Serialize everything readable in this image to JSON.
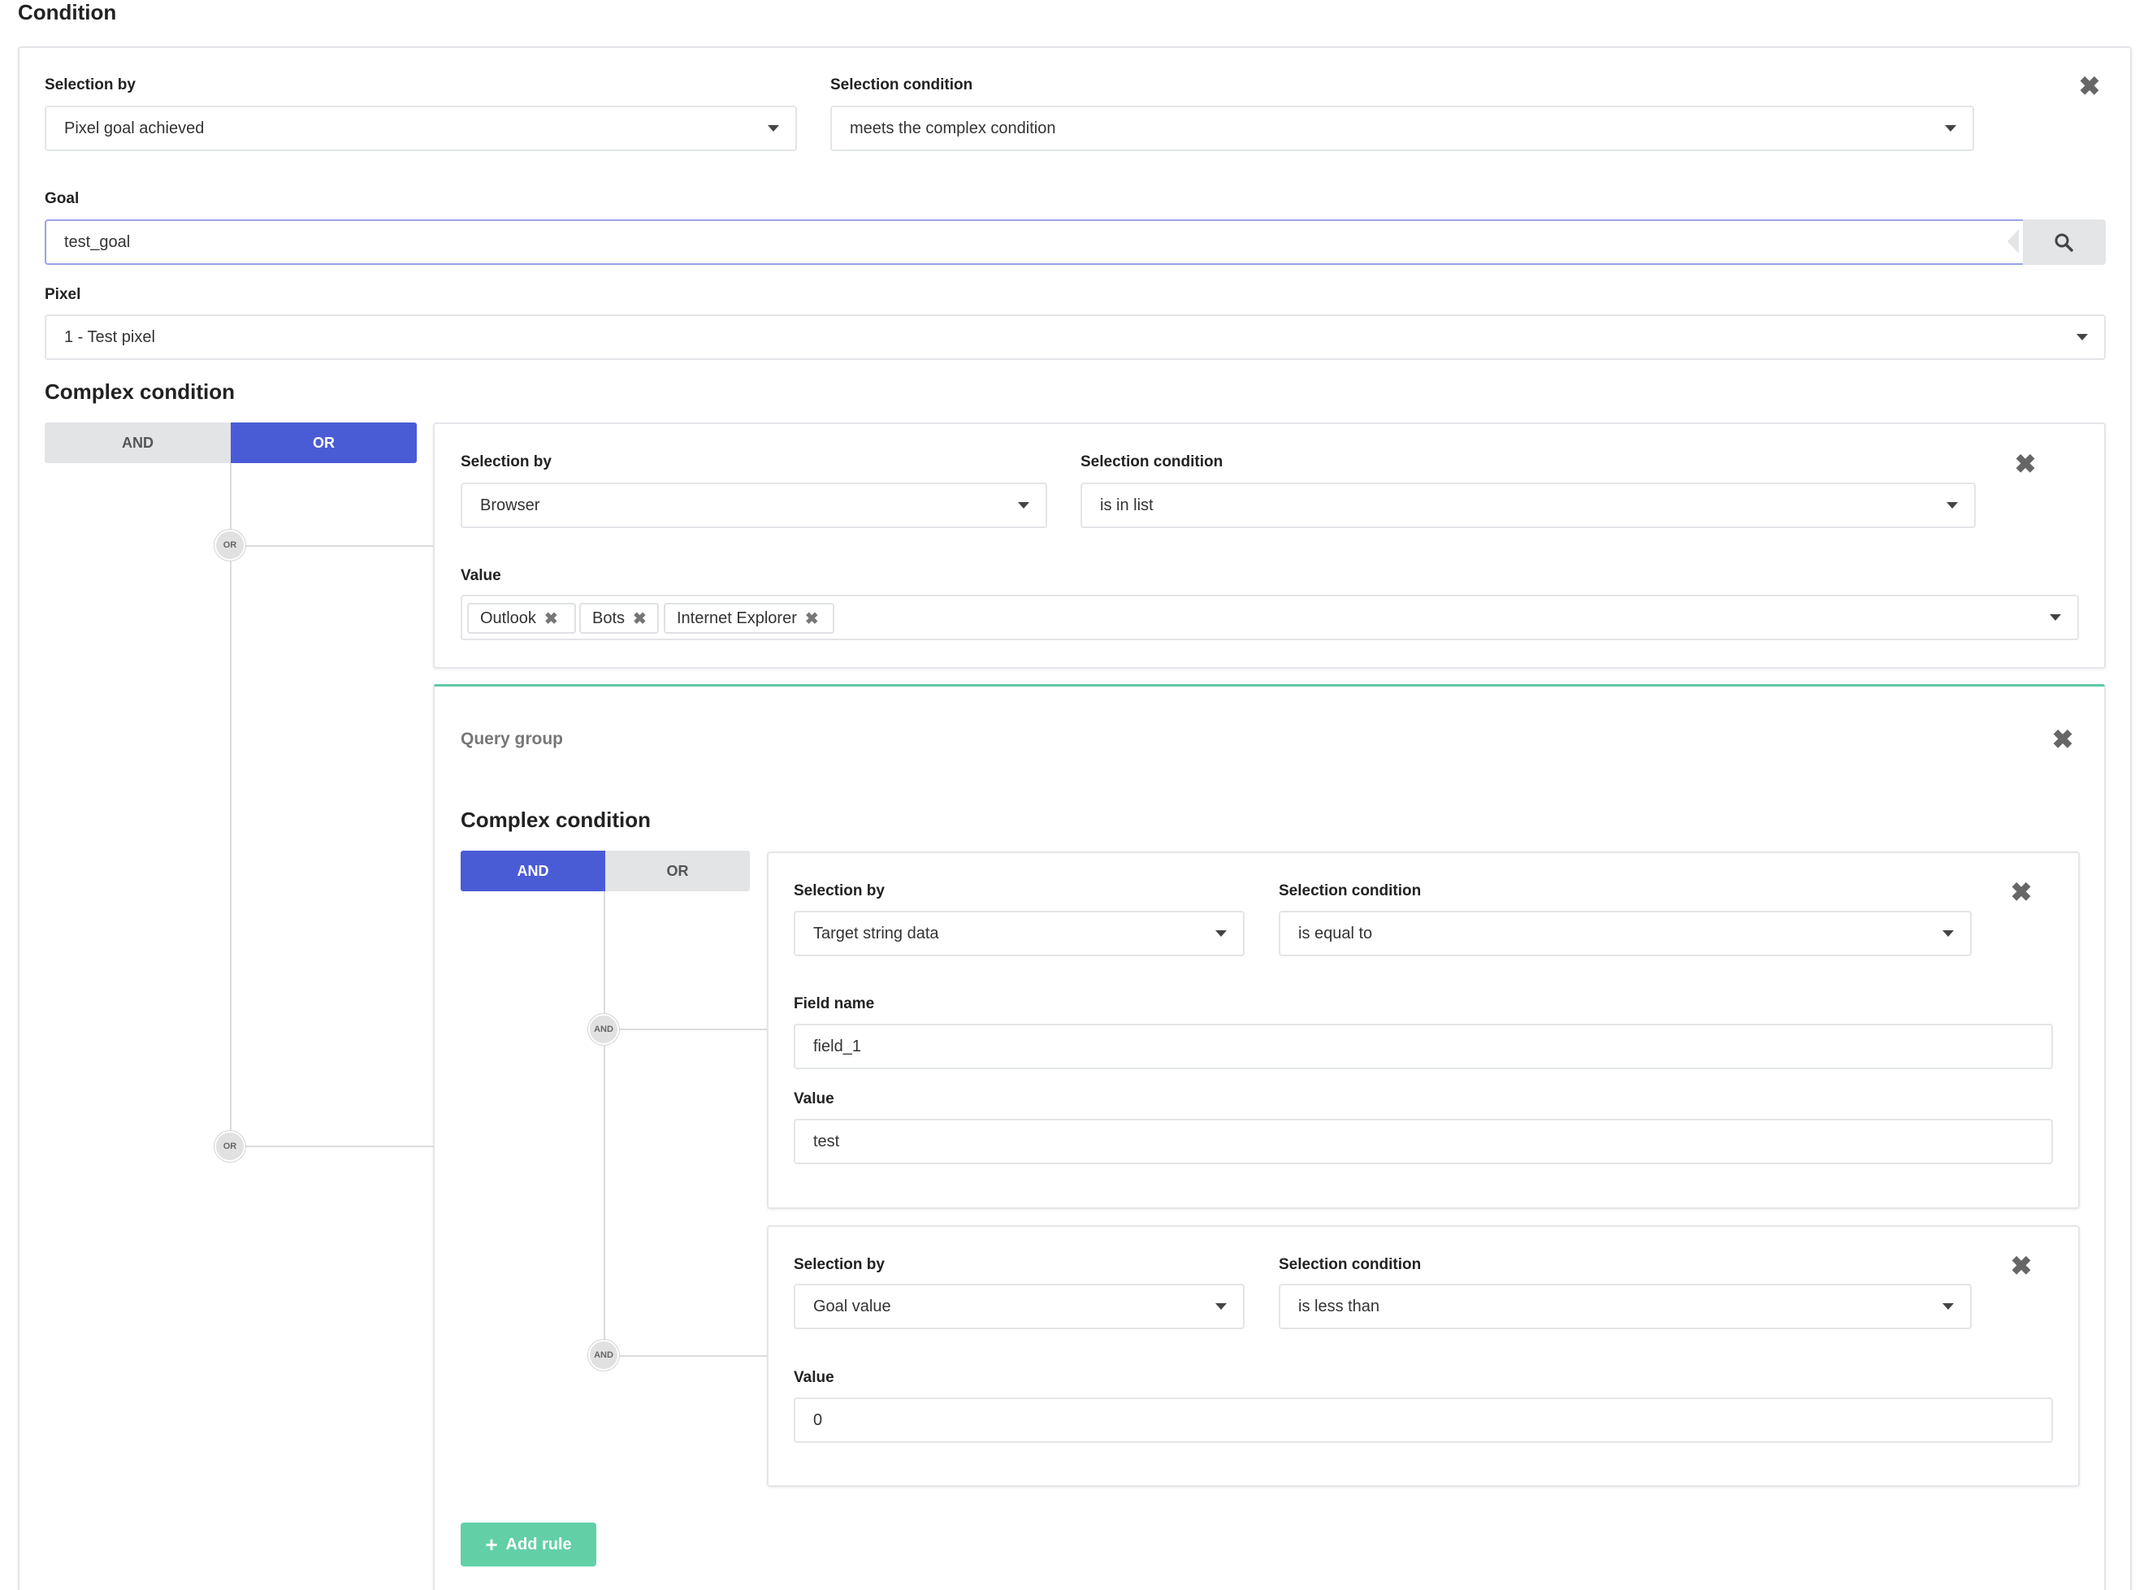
{
  "page": {
    "title": "Condition"
  },
  "main_rule": {
    "selection_by_label": "Selection by",
    "selection_by_value": "Pixel goal achieved",
    "selection_condition_label": "Selection condition",
    "selection_condition_value": "meets the complex condition",
    "goal_label": "Goal",
    "goal_value": "test_goal",
    "pixel_label": "Pixel",
    "pixel_value": "1 - Test pixel",
    "complex_title": "Complex condition",
    "toggle": {
      "and": "AND",
      "or": "OR",
      "active": "OR"
    },
    "node_label": "OR"
  },
  "browser_rule": {
    "selection_by_label": "Selection by",
    "selection_by_value": "Browser",
    "selection_condition_label": "Selection condition",
    "selection_condition_value": "is in list",
    "value_label": "Value",
    "tags": [
      "Outlook",
      "Bots",
      "Internet Explorer"
    ]
  },
  "query_group": {
    "title": "Query group",
    "complex_title": "Complex condition",
    "toggle": {
      "and": "AND",
      "or": "OR",
      "active": "AND"
    },
    "node_label": "AND",
    "rule1": {
      "selection_by_label": "Selection by",
      "selection_by_value": "Target string data",
      "selection_condition_label": "Selection condition",
      "selection_condition_value": "is equal to",
      "field_name_label": "Field name",
      "field_name_value": "field_1",
      "value_label": "Value",
      "value_value": "test"
    },
    "rule2": {
      "selection_by_label": "Selection by",
      "selection_by_value": "Goal value",
      "selection_condition_label": "Selection condition",
      "selection_condition_value": "is less than",
      "value_label": "Value",
      "value_value": "0"
    },
    "add_rule_label": "Add rule"
  },
  "colors": {
    "accent": "#4a5bd6",
    "success": "#62cfa7",
    "group_border": "#5fc9a3"
  }
}
